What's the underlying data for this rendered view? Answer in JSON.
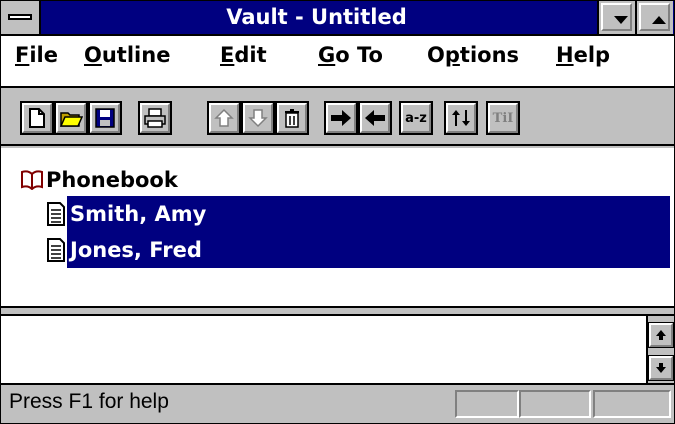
{
  "window": {
    "title": "Vault - Untitled"
  },
  "menu": [
    {
      "label": "File",
      "mnemonic": "F",
      "rest": "ile"
    },
    {
      "label": "Outline",
      "mnemonic": "O",
      "rest": "utline"
    },
    {
      "label": "Edit",
      "mnemonic": "E",
      "rest": "dit"
    },
    {
      "label": "Go To",
      "mnemonic": "G",
      "rest": "o To"
    },
    {
      "label": "Options",
      "pre": "O",
      "mnemonic": "p",
      "rest": "tions"
    },
    {
      "label": "Help",
      "mnemonic": "H",
      "rest": "elp"
    }
  ],
  "toolbar": {
    "sort_label": "a-z",
    "format_label": "TiI",
    "icons": [
      "new-document-icon",
      "open-folder-icon",
      "save-disk-icon",
      "print-icon",
      "move-up-icon",
      "move-down-icon",
      "delete-trash-icon",
      "indent-right-icon",
      "outdent-left-icon",
      "sort-az-icon",
      "move-updown-icon",
      "format-icon"
    ]
  },
  "outline": {
    "root": {
      "label": "Phonebook",
      "icon": "open-book-icon"
    },
    "children": [
      {
        "label": "Smith, Amy",
        "icon": "document-icon",
        "selected": true
      },
      {
        "label": "Jones, Fred",
        "icon": "document-icon",
        "selected": true
      }
    ]
  },
  "statusbar": {
    "text": "Press F1 for help"
  },
  "colors": {
    "title_bg": "#000080",
    "selection_bg": "#000080",
    "face": "#c0c0c0"
  }
}
